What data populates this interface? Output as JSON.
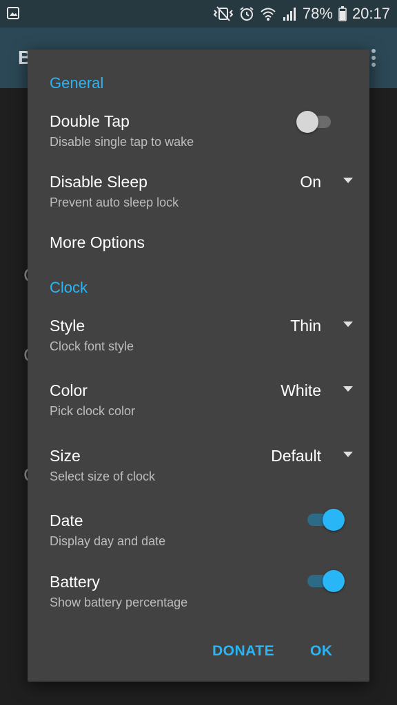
{
  "status_bar": {
    "battery_percent": "78%",
    "time": "20:17",
    "icons": [
      "gallery-icon",
      "vibrate-mute-icon",
      "alarm-icon",
      "wifi-icon",
      "signal-icon",
      "battery-icon"
    ]
  },
  "app_bar": {
    "title_fragment": "B"
  },
  "dialog": {
    "general_header": "General",
    "double_tap": {
      "title": "Double Tap",
      "summary": "Disable single tap to wake",
      "enabled": false
    },
    "disable_sleep": {
      "title": "Disable Sleep",
      "summary": "Prevent auto sleep lock",
      "value": "On"
    },
    "more_options": {
      "title": "More Options"
    },
    "clock_header": "Clock",
    "style": {
      "title": "Style",
      "summary": "Clock font style",
      "value": "Thin"
    },
    "color": {
      "title": "Color",
      "summary": "Pick clock color",
      "value": "White"
    },
    "size": {
      "title": "Size",
      "summary": "Select size of clock",
      "value": "Default"
    },
    "date": {
      "title": "Date",
      "summary": "Display day and date",
      "enabled": true
    },
    "battery": {
      "title": "Battery",
      "summary": "Show battery percentage",
      "enabled": true
    },
    "buttons": {
      "donate": "DONATE",
      "ok": "OK"
    }
  },
  "colors": {
    "accent": "#29b6f6",
    "dialog_bg": "#424242",
    "appbar_bg": "#2c4856"
  }
}
